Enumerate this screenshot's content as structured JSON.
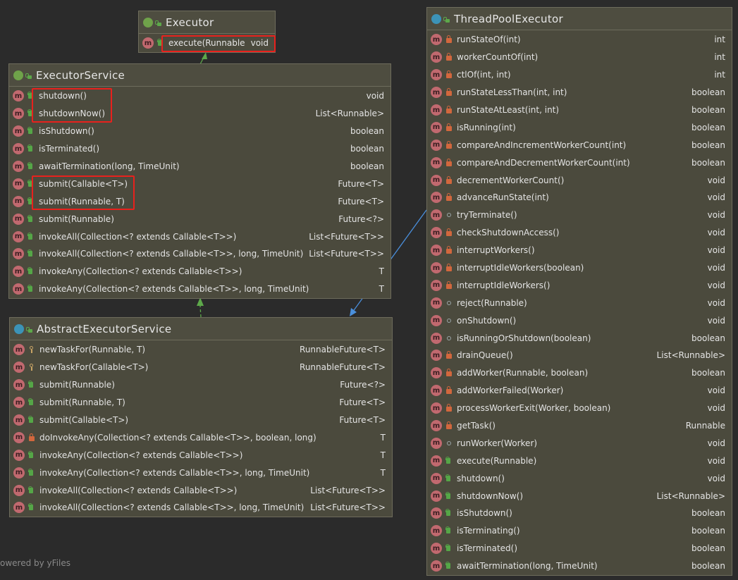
{
  "diagram": {
    "credit": "owered by yFiles",
    "colors": {
      "background": "#2b2b2b",
      "class_fill": "#4b4a3d",
      "class_border": "#6e6c5c",
      "interface_badge": "#6fa24a",
      "class_badge": "#3c93b7",
      "method_icon": "#c1696f",
      "public_lock": "#55a647",
      "private_lock": "#d2673d",
      "highlight_box": "#e8211d",
      "extends_arrow": "#5da84a",
      "implements_arrow": "#4a8fdc"
    },
    "classes": [
      {
        "id": "executor",
        "kind": "I",
        "name": "Executor",
        "methods": [
          {
            "name": "execute(Runnable)",
            "type": "void",
            "vis": "public"
          }
        ]
      },
      {
        "id": "executor-service",
        "kind": "I",
        "name": "ExecutorService",
        "methods": [
          {
            "name": "shutdown()",
            "type": "void",
            "vis": "public"
          },
          {
            "name": "shutdownNow()",
            "type": "List<Runnable>",
            "vis": "public"
          },
          {
            "name": "isShutdown()",
            "type": "boolean",
            "vis": "public"
          },
          {
            "name": "isTerminated()",
            "type": "boolean",
            "vis": "public"
          },
          {
            "name": "awaitTermination(long, TimeUnit)",
            "type": "boolean",
            "vis": "public"
          },
          {
            "name": "submit(Callable<T>)",
            "type": "Future<T>",
            "vis": "public"
          },
          {
            "name": "submit(Runnable, T)",
            "type": "Future<T>",
            "vis": "public"
          },
          {
            "name": "submit(Runnable)",
            "type": "Future<?>",
            "vis": "public"
          },
          {
            "name": "invokeAll(Collection<? extends Callable<T>>)",
            "type": "List<Future<T>>",
            "vis": "public"
          },
          {
            "name": "invokeAll(Collection<? extends Callable<T>>, long, TimeUnit)",
            "type": "List<Future<T>>",
            "vis": "public"
          },
          {
            "name": "invokeAny(Collection<? extends Callable<T>>)",
            "type": "T",
            "vis": "public"
          },
          {
            "name": "invokeAny(Collection<? extends Callable<T>>, long, TimeUnit)",
            "type": "T",
            "vis": "public"
          }
        ]
      },
      {
        "id": "abstract-executor-service",
        "kind": "C",
        "name": "AbstractExecutorService",
        "methods": [
          {
            "name": "newTaskFor(Runnable, T)",
            "type": "RunnableFuture<T>",
            "vis": "protected"
          },
          {
            "name": "newTaskFor(Callable<T>)",
            "type": "RunnableFuture<T>",
            "vis": "protected"
          },
          {
            "name": "submit(Runnable)",
            "type": "Future<?>",
            "vis": "public"
          },
          {
            "name": "submit(Runnable, T)",
            "type": "Future<T>",
            "vis": "public"
          },
          {
            "name": "submit(Callable<T>)",
            "type": "Future<T>",
            "vis": "public"
          },
          {
            "name": "doInvokeAny(Collection<? extends Callable<T>>, boolean, long)",
            "type": "T",
            "vis": "private"
          },
          {
            "name": "invokeAny(Collection<? extends Callable<T>>)",
            "type": "T",
            "vis": "public"
          },
          {
            "name": "invokeAny(Collection<? extends Callable<T>>, long, TimeUnit)",
            "type": "T",
            "vis": "public"
          },
          {
            "name": "invokeAll(Collection<? extends Callable<T>>)",
            "type": "List<Future<T>>",
            "vis": "public"
          },
          {
            "name": "invokeAll(Collection<? extends Callable<T>>, long, TimeUnit)",
            "type": "List<Future<T>>",
            "vis": "public"
          }
        ]
      },
      {
        "id": "thread-pool-executor",
        "kind": "C",
        "name": "ThreadPoolExecutor",
        "methods": [
          {
            "name": "runStateOf(int)",
            "type": "int",
            "vis": "private"
          },
          {
            "name": "workerCountOf(int)",
            "type": "int",
            "vis": "private"
          },
          {
            "name": "ctlOf(int, int)",
            "type": "int",
            "vis": "private"
          },
          {
            "name": "runStateLessThan(int, int)",
            "type": "boolean",
            "vis": "private"
          },
          {
            "name": "runStateAtLeast(int, int)",
            "type": "boolean",
            "vis": "private"
          },
          {
            "name": "isRunning(int)",
            "type": "boolean",
            "vis": "private"
          },
          {
            "name": "compareAndIncrementWorkerCount(int)",
            "type": "boolean",
            "vis": "private"
          },
          {
            "name": "compareAndDecrementWorkerCount(int)",
            "type": "boolean",
            "vis": "private"
          },
          {
            "name": "decrementWorkerCount()",
            "type": "void",
            "vis": "private"
          },
          {
            "name": "advanceRunState(int)",
            "type": "void",
            "vis": "private"
          },
          {
            "name": "tryTerminate()",
            "type": "void",
            "vis": "package"
          },
          {
            "name": "checkShutdownAccess()",
            "type": "void",
            "vis": "private"
          },
          {
            "name": "interruptWorkers()",
            "type": "void",
            "vis": "private"
          },
          {
            "name": "interruptIdleWorkers(boolean)",
            "type": "void",
            "vis": "private"
          },
          {
            "name": "interruptIdleWorkers()",
            "type": "void",
            "vis": "private"
          },
          {
            "name": "reject(Runnable)",
            "type": "void",
            "vis": "package"
          },
          {
            "name": "onShutdown()",
            "type": "void",
            "vis": "package"
          },
          {
            "name": "isRunningOrShutdown(boolean)",
            "type": "boolean",
            "vis": "package"
          },
          {
            "name": "drainQueue()",
            "type": "List<Runnable>",
            "vis": "private"
          },
          {
            "name": "addWorker(Runnable, boolean)",
            "type": "boolean",
            "vis": "private"
          },
          {
            "name": "addWorkerFailed(Worker)",
            "type": "void",
            "vis": "private"
          },
          {
            "name": "processWorkerExit(Worker, boolean)",
            "type": "void",
            "vis": "private"
          },
          {
            "name": "getTask()",
            "type": "Runnable",
            "vis": "private"
          },
          {
            "name": "runWorker(Worker)",
            "type": "void",
            "vis": "package"
          },
          {
            "name": "execute(Runnable)",
            "type": "void",
            "vis": "public"
          },
          {
            "name": "shutdown()",
            "type": "void",
            "vis": "public"
          },
          {
            "name": "shutdownNow()",
            "type": "List<Runnable>",
            "vis": "public"
          },
          {
            "name": "isShutdown()",
            "type": "boolean",
            "vis": "public"
          },
          {
            "name": "isTerminating()",
            "type": "boolean",
            "vis": "public"
          },
          {
            "name": "isTerminated()",
            "type": "boolean",
            "vis": "public"
          },
          {
            "name": "awaitTermination(long, TimeUnit)",
            "type": "boolean",
            "vis": "public"
          }
        ]
      }
    ],
    "relations": [
      {
        "from": "executor-service",
        "to": "executor",
        "kind": "extends"
      },
      {
        "from": "abstract-executor-service",
        "to": "executor-service",
        "kind": "implements"
      },
      {
        "from": "thread-pool-executor",
        "to": "abstract-executor-service",
        "kind": "extends"
      }
    ],
    "highlights": [
      {
        "class": "executor",
        "first_row": 0,
        "last_row": 0
      },
      {
        "class": "executor-service",
        "first_row": 0,
        "last_row": 1
      },
      {
        "class": "executor-service",
        "first_row": 5,
        "last_row": 6
      }
    ]
  }
}
